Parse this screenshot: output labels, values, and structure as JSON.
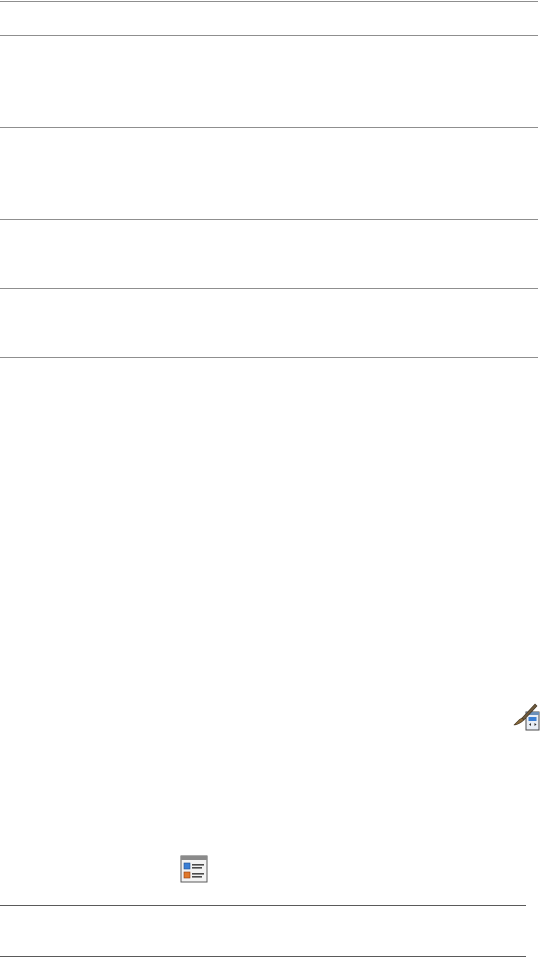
{
  "icons": {
    "properties_brush": "paintbrush-properties-window-icon",
    "details_list": "details-list-window-icon"
  },
  "colors": {
    "rule_light": "#8f8f8f",
    "rule_dark": "#5a5a5a",
    "accent_blue": "#3a7fd5",
    "accent_orange": "#e0782a"
  }
}
